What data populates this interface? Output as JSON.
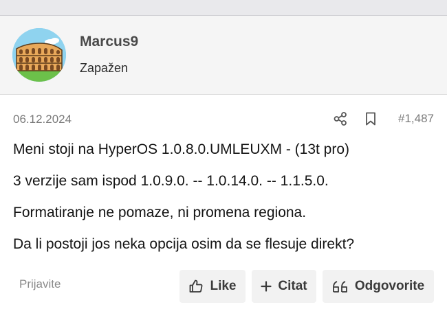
{
  "user": {
    "name": "Marcus9",
    "title": "Zapažen",
    "avatar_icon": "colosseum-avatar"
  },
  "post": {
    "date": "06.12.2024",
    "number": "#1,487",
    "lines": [
      "Meni stoji na HyperOS 1.0.8.0.UMLEUXM - (13t pro)",
      "3 verzije sam ispod 1.0.9.0. -- 1.0.14.0. -- 1.1.5.0.",
      "Formatiranje ne pomaze, ni promena regiona.",
      "Da li postoji jos neka opcija osim da se flesuje direkt?"
    ]
  },
  "meta_icons": [
    "share-icon",
    "bookmark-icon"
  ],
  "footer": {
    "report_label": "Prijavite",
    "like_label": "Like",
    "quote_label": "Citat",
    "reply_label": "Odgovorite"
  },
  "colors": {
    "header_bg": "#f5f5f5",
    "button_bg": "#f2f2f2",
    "muted_text": "#7a7a7a",
    "avatar_sky": "#8fd3ef",
    "avatar_ground": "#6cc04a"
  }
}
